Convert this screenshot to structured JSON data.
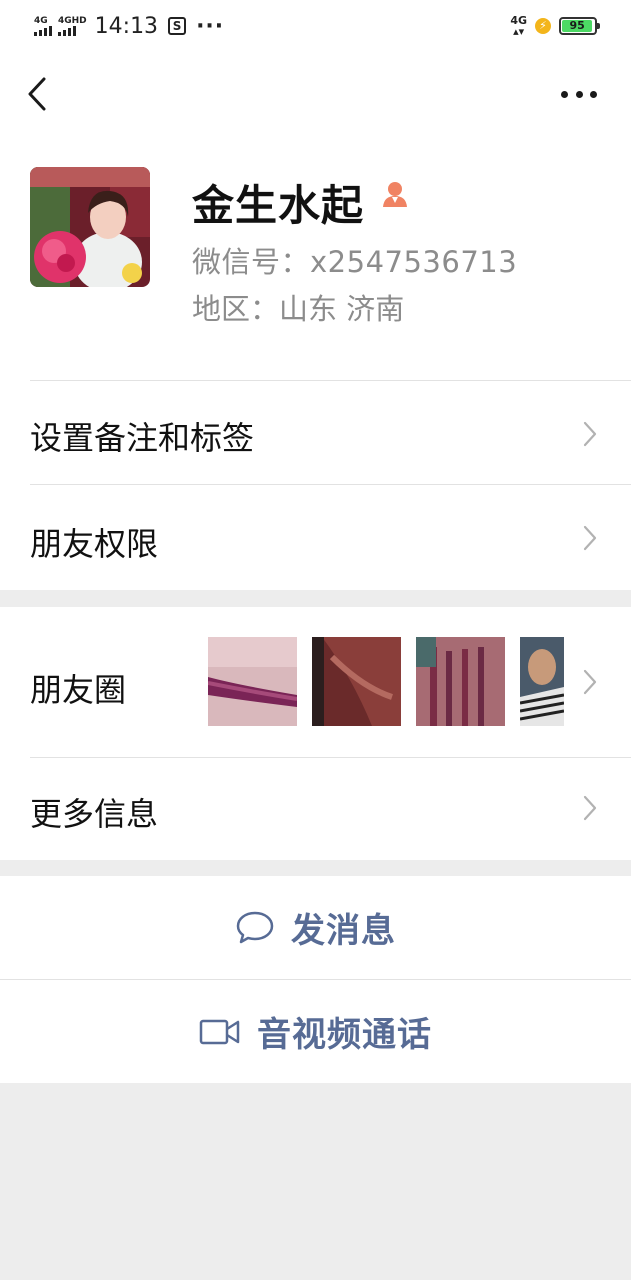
{
  "status_bar": {
    "signal1_label": "4G",
    "signal2_label": "4GHD",
    "time": "14:13",
    "app_icon_glyph": "S",
    "more_glyph": "···",
    "network_right": "4G",
    "battery_level": "95",
    "battery_fraction": 0.95
  },
  "nav": {
    "back_icon": "chevron-left-icon",
    "more_icon": "more-dots-icon"
  },
  "profile": {
    "name": "金生水起",
    "gender_icon": "female-user-icon",
    "wechat_id": "微信号：x2547536713",
    "region": "地区：山东  济南"
  },
  "menu": {
    "remark_tags": "设置备注和标签",
    "permissions": "朋友权限",
    "moments": "朋友圈",
    "more_info": "更多信息"
  },
  "actions": {
    "message": "发消息",
    "call": "音视频通话"
  },
  "colors": {
    "accent_link": "#576b95",
    "background": "#ededed",
    "battery_green": "#4cd964",
    "gender_icon": "#f08363"
  }
}
